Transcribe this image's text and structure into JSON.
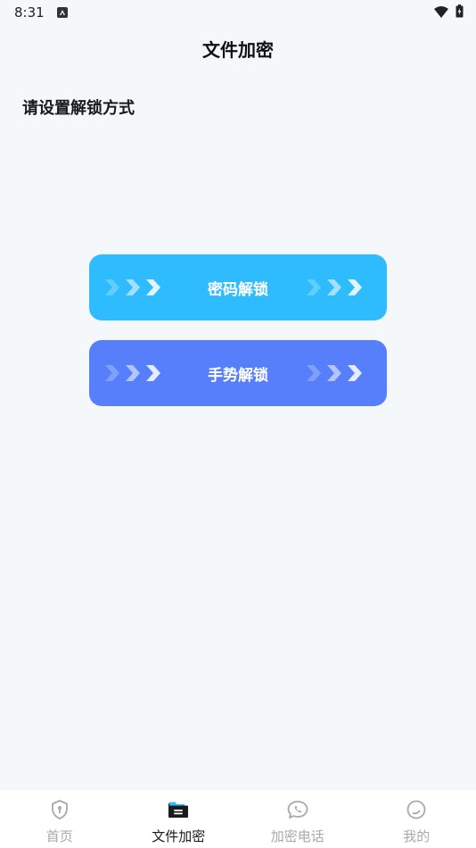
{
  "status_bar": {
    "time": "8:31"
  },
  "header": {
    "title": "文件加密"
  },
  "main": {
    "section_label": "请设置解锁方式",
    "buttons": [
      {
        "label": "密码解锁",
        "color": "#2ebcff"
      },
      {
        "label": "手势解锁",
        "color": "#577ffc"
      }
    ]
  },
  "tabbar": {
    "tabs": [
      {
        "label": "首页",
        "icon": "shield-icon",
        "active": false
      },
      {
        "label": "文件加密",
        "icon": "folder-icon",
        "active": true
      },
      {
        "label": "加密电话",
        "icon": "phone-chat-icon",
        "active": false
      },
      {
        "label": "我的",
        "icon": "profile-icon",
        "active": false
      }
    ]
  },
  "colors": {
    "background": "#f4f8fb",
    "inactive_tab": "#a6a9ad",
    "active_tab": "#1b1b1b"
  }
}
